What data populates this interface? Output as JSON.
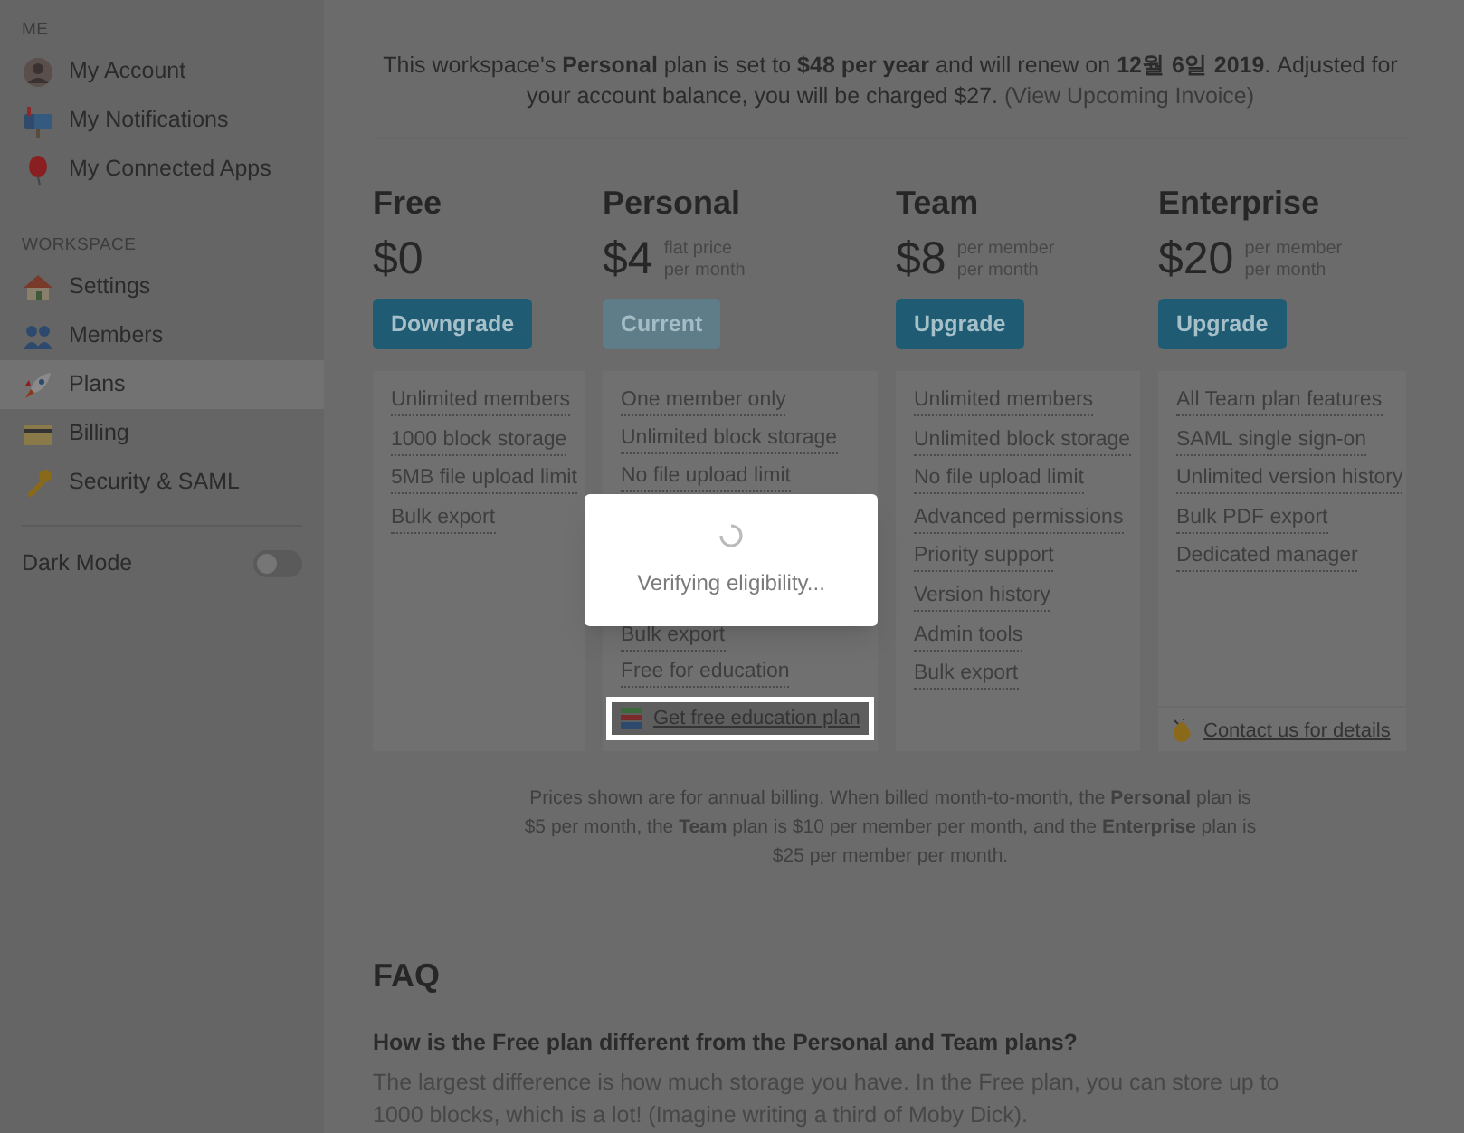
{
  "sidebar": {
    "sections": [
      {
        "heading": "ME",
        "items": [
          {
            "label": "My Account",
            "kind": "avatar",
            "selected": false
          },
          {
            "label": "My Notifications",
            "kind": "mailbox",
            "selected": false
          },
          {
            "label": "My Connected Apps",
            "kind": "balloon",
            "selected": false
          }
        ]
      },
      {
        "heading": "WORKSPACE",
        "items": [
          {
            "label": "Settings",
            "kind": "house",
            "selected": false
          },
          {
            "label": "Members",
            "kind": "people",
            "selected": false
          },
          {
            "label": "Plans",
            "kind": "rocket",
            "selected": true
          },
          {
            "label": "Billing",
            "kind": "card",
            "selected": false
          },
          {
            "label": "Security & SAML",
            "kind": "key",
            "selected": false
          }
        ]
      }
    ],
    "dark_mode": {
      "label": "Dark Mode",
      "on": false
    }
  },
  "notice": {
    "text": "This workspace's **Personal** plan is set to **$48 per year** and will renew on **12월 6일 2019**. Adjusted for your account balance, you will be charged $27.",
    "link": "(View Upcoming Invoice)"
  },
  "plans": [
    {
      "name": "Free",
      "price": "$0",
      "button": {
        "label": "Downgrade",
        "disabled": false
      },
      "features": [
        "Unlimited members",
        "1000 block storage",
        "5MB file upload limit",
        "Bulk export"
      ]
    },
    {
      "name": "Personal",
      "price": "$4",
      "price_note": [
        "flat price",
        "per month"
      ],
      "button": {
        "label": "Current",
        "disabled": true
      },
      "features": [
        "One member only",
        "Unlimited block storage",
        "No file upload limit"
      ],
      "features_after_dialog": [
        "Bulk export",
        "Free for education"
      ],
      "footer_link": {
        "label": "Get free education plan",
        "kind": "books",
        "highlighted": true
      }
    },
    {
      "name": "Team",
      "price": "$8",
      "price_note": [
        "per member",
        "per month"
      ],
      "button": {
        "label": "Upgrade",
        "disabled": false
      },
      "features": [
        "Unlimited members",
        "Unlimited block storage",
        "No file upload limit",
        "Advanced permissions",
        "Priority support",
        "Version history",
        "Admin tools",
        "Bulk export"
      ]
    },
    {
      "name": "Enterprise",
      "price": "$20",
      "price_note": [
        "per member",
        "per month"
      ],
      "button": {
        "label": "Upgrade",
        "disabled": false
      },
      "features": [
        "All Team plan features",
        "SAML single sign-on",
        "Unlimited version history",
        "Bulk PDF export",
        "Dedicated manager"
      ],
      "footer_link": {
        "label": "Contact us for details",
        "kind": "hands",
        "highlighted": false
      }
    }
  ],
  "pricing_note": "Prices shown are for annual billing. When billed month-to-month, the **Personal** plan is $5 per month, the **Team** plan is $10 per member per month, and the **Enterprise** plan is $25 per member per month.",
  "faq": {
    "title": "FAQ",
    "question": "How is the Free plan different from the Personal and Team plans?",
    "answer": "The largest difference is how much storage you have. In the Free plan, you can store up to 1000 blocks, which is a lot! (Imagine writing a third of Moby Dick)."
  },
  "dialog": {
    "message": "Verifying eligibility..."
  }
}
